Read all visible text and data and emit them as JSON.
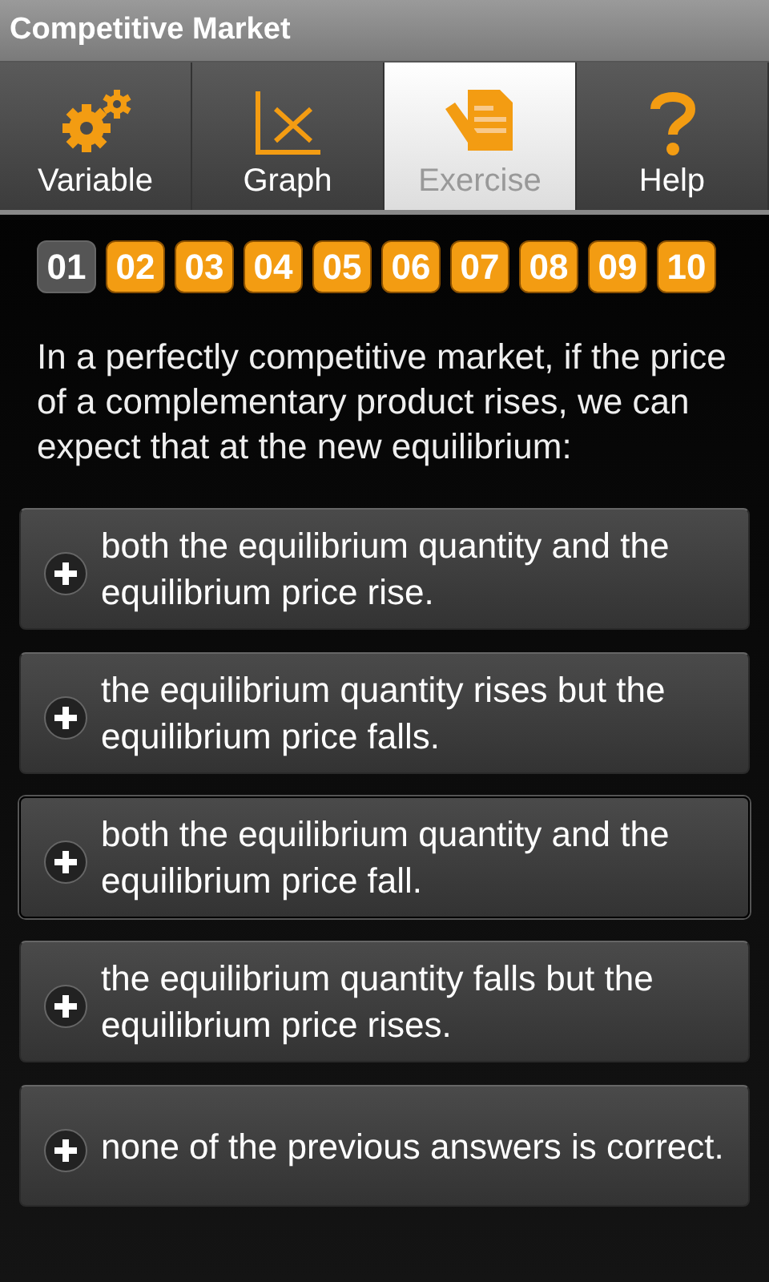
{
  "window": {
    "title": "Competitive Market"
  },
  "tabs": [
    {
      "label": "Variable",
      "kind": "gears",
      "selected": false
    },
    {
      "label": "Graph",
      "kind": "graph",
      "selected": false
    },
    {
      "label": "Exercise",
      "kind": "exercise",
      "selected": true
    },
    {
      "label": "Help",
      "kind": "help",
      "selected": false
    }
  ],
  "questions": [
    {
      "label": "01",
      "selected": true
    },
    {
      "label": "02",
      "selected": false
    },
    {
      "label": "03",
      "selected": false
    },
    {
      "label": "04",
      "selected": false
    },
    {
      "label": "05",
      "selected": false
    },
    {
      "label": "06",
      "selected": false
    },
    {
      "label": "07",
      "selected": false
    },
    {
      "label": "08",
      "selected": false
    },
    {
      "label": "09",
      "selected": false
    },
    {
      "label": "10",
      "selected": false
    }
  ],
  "question": "In a perfectly competitive market, if the price of a complementary product rises, we can expect that at the new equilibrium:",
  "answers": [
    {
      "text": "both the equilibrium quantity and the equilibrium price rise.",
      "selected": false
    },
    {
      "text": "the equilibrium quantity rises but the equilibrium price falls.",
      "selected": false
    },
    {
      "text": "both the equilibrium quantity and the equilibrium price fall.",
      "selected": true
    },
    {
      "text": "the equilibrium quantity falls but the equilibrium price rises.",
      "selected": false
    },
    {
      "text": "none of the previous answers is correct.",
      "selected": false
    }
  ]
}
